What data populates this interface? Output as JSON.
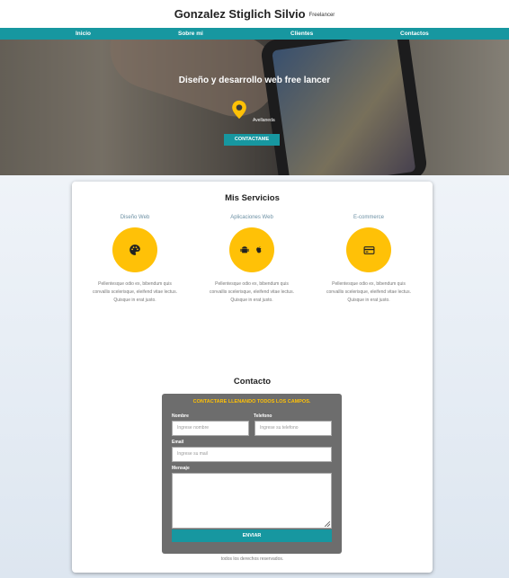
{
  "header": {
    "title": "Gonzalez Stiglich Silvio",
    "subtitle": "Freelancer"
  },
  "nav": {
    "items": [
      {
        "label": "Inicio"
      },
      {
        "label": "Sobre mi"
      },
      {
        "label": "Clientes"
      },
      {
        "label": "Contactos"
      }
    ]
  },
  "hero": {
    "title": "Diseño y desarrollo web free lancer",
    "location": "Avellaneda",
    "cta_label": "CONTACTAME"
  },
  "services": {
    "title": "Mis Servicios",
    "items": [
      {
        "name": "Diseño Web",
        "icon": "palette-icon",
        "text": "Pellentesque odio ex, bibendum quis convallis scelerisque, eleifend vitae lectus. Quisque in erat justo."
      },
      {
        "name": "Aplicaciones Web",
        "icon": "android-apple-icon",
        "text": "Pellentesque odio ex, bibendum quis convallis scelerisque, eleifend vitae lectus. Quisque in erat justo."
      },
      {
        "name": "E-commerce",
        "icon": "credit-card-icon",
        "text": "Pellentesque odio ex, bibendum quis convallis scelerisque, eleifend vitae lectus. Quisque in erat justo."
      }
    ]
  },
  "contact": {
    "title": "Contacto",
    "form_heading": "CONTACTARE LLENANDO TODOS LOS CAMPOS.",
    "name_label": "Nombre",
    "name_placeholder": "Ingrese nombre",
    "phone_label": "Telefono",
    "phone_placeholder": "Ingrese su telefono",
    "email_label": "Email",
    "email_placeholder": "Ingrese su mail",
    "message_label": "Mensaje",
    "submit_label": "ENVIAR"
  },
  "footer": {
    "text": "todos los derechos reservados."
  },
  "colors": {
    "accent": "#1797a0",
    "highlight": "#ffc107",
    "form_bg": "#6d6d6d"
  }
}
